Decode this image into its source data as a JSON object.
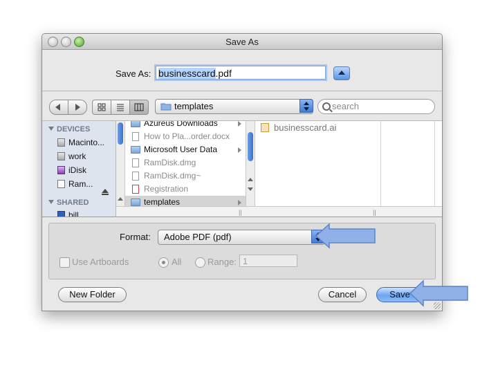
{
  "window": {
    "title": "Save As"
  },
  "save_as": {
    "label": "Save As:",
    "filename_base": "businesscard",
    "filename_ext": ".pdf"
  },
  "toolbar": {
    "back_icon": "chevron-left-icon",
    "forward_icon": "chevron-right-icon",
    "view_icons": [
      "icon-view-icon",
      "list-view-icon",
      "column-view-icon"
    ],
    "location": "templates",
    "search_placeholder": "search"
  },
  "sidebar": {
    "devices_header": "DEVICES",
    "devices": [
      {
        "label": "Macinto...",
        "icon": "hard-disk-icon"
      },
      {
        "label": "work",
        "icon": "hard-disk-icon"
      },
      {
        "label": "iDisk",
        "icon": "idisk-icon"
      },
      {
        "label": "Ram...",
        "icon": "document-icon"
      }
    ],
    "shared_header": "SHARED",
    "shared": [
      {
        "label": "bill",
        "icon": "network-computer-icon"
      }
    ]
  },
  "browser": {
    "column2": [
      {
        "label": "Azureus Downloads",
        "icon": "folder-icon",
        "dim": false,
        "arrow": true,
        "selected": false
      },
      {
        "label": "How to Pla...order.docx",
        "icon": "document-icon",
        "dim": true,
        "arrow": false,
        "selected": false
      },
      {
        "label": "Microsoft User Data",
        "icon": "folder-icon",
        "dim": false,
        "arrow": true,
        "selected": false
      },
      {
        "label": "RamDisk.dmg",
        "icon": "document-icon",
        "dim": true,
        "arrow": false,
        "selected": false
      },
      {
        "label": "RamDisk.dmg~",
        "icon": "document-icon",
        "dim": true,
        "arrow": false,
        "selected": false
      },
      {
        "label": "Registration",
        "icon": "pdf-icon",
        "dim": true,
        "arrow": false,
        "selected": false
      },
      {
        "label": "templates",
        "icon": "folder-icon",
        "dim": false,
        "arrow": true,
        "selected": true
      }
    ],
    "column3": [
      {
        "label": "businesscard.ai",
        "icon": "illustrator-file-icon"
      }
    ]
  },
  "options": {
    "format_label": "Format:",
    "format_value": "Adobe PDF (pdf)",
    "use_artboards_label": "Use Artboards",
    "use_artboards_checked": false,
    "all_label": "All",
    "range_label": "Range:",
    "range_value": "1"
  },
  "buttons": {
    "new_folder": "New Folder",
    "cancel": "Cancel",
    "save": "Save"
  },
  "colors": {
    "accent": "#5a93e6",
    "callout_arrow": "#8fb1e8",
    "selection": "#b5d5ff"
  }
}
